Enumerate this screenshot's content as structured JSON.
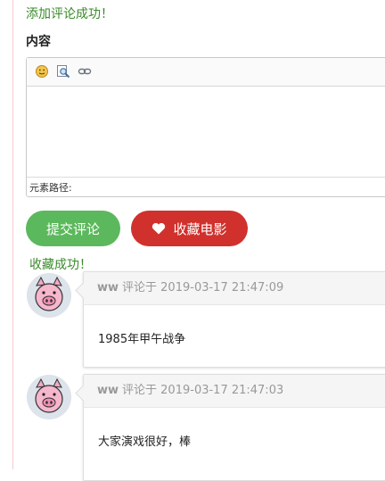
{
  "messages": {
    "comment_added": "添加评论成功！",
    "favorited": "收藏成功！"
  },
  "form": {
    "content_label": "内容",
    "editor": {
      "toolbar_icons": [
        "emoji-icon",
        "preview-icon",
        "link-icon"
      ],
      "status_label": "元素路径:"
    },
    "submit_label": "提交评论",
    "favorite_label": "收藏电影"
  },
  "colors": {
    "success_text": "#3a8a2a",
    "submit_button": "#5cb85c",
    "favorite_button": "#d0312d"
  },
  "comments": [
    {
      "user": "ww",
      "meta": "评论于 2019-03-17 21:47:09",
      "text": "1985年甲午战争"
    },
    {
      "user": "ww",
      "meta": "评论于 2019-03-17 21:47:03",
      "text": "大家演戏很好，棒"
    }
  ]
}
